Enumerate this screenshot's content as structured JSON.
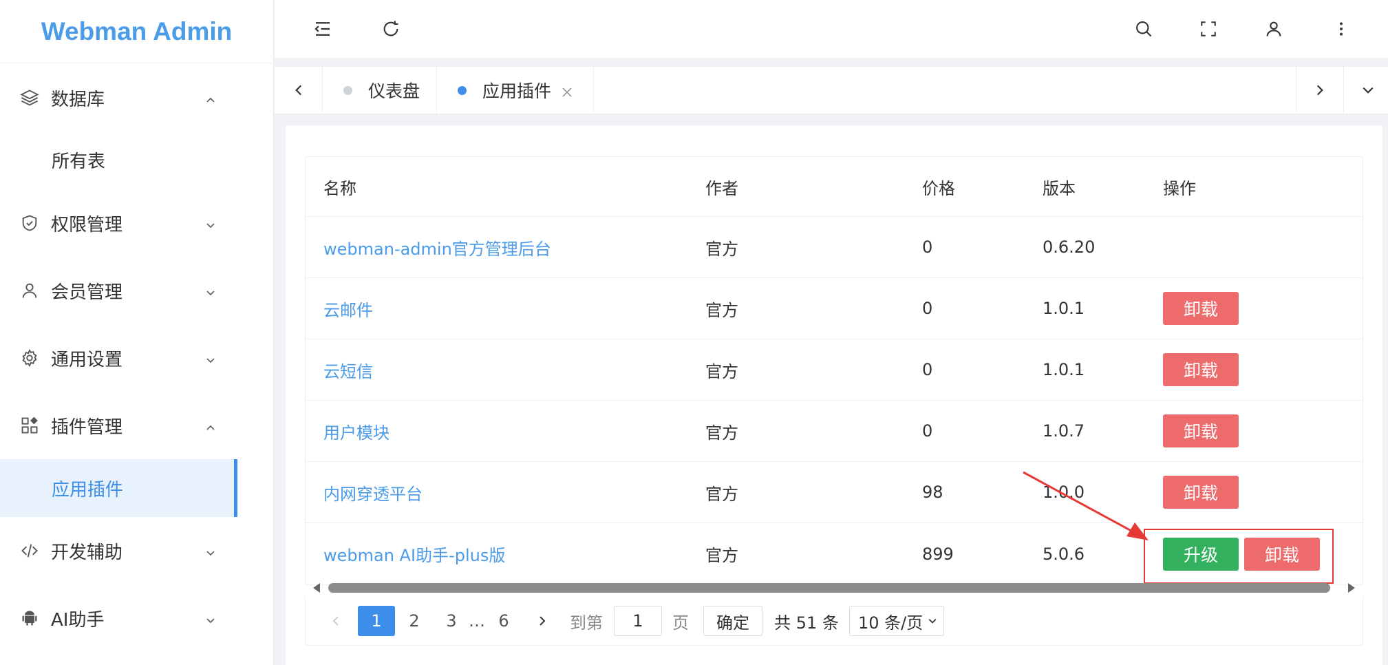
{
  "app": {
    "title": "Webman Admin"
  },
  "sidebar": {
    "items": [
      {
        "label": "数据库",
        "icon": "layers-icon",
        "expanded": true
      },
      {
        "label": "所有表",
        "sub": true
      },
      {
        "label": "权限管理",
        "icon": "shield-icon",
        "expanded": false
      },
      {
        "label": "会员管理",
        "icon": "user-icon",
        "expanded": false
      },
      {
        "label": "通用设置",
        "icon": "gear-icon",
        "expanded": false
      },
      {
        "label": "插件管理",
        "icon": "apps-icon",
        "expanded": true
      },
      {
        "label": "应用插件",
        "sub": true,
        "active": true
      },
      {
        "label": "开发辅助",
        "icon": "code-icon",
        "expanded": false
      },
      {
        "label": "AI助手",
        "icon": "android-icon",
        "expanded": false
      }
    ]
  },
  "tabs": [
    {
      "label": "仪表盘",
      "active": false
    },
    {
      "label": "应用插件",
      "active": true
    }
  ],
  "table": {
    "headers": {
      "name": "名称",
      "author": "作者",
      "price": "价格",
      "version": "版本",
      "ops": "操作"
    },
    "rows": [
      {
        "name": "webman-admin官方管理后台",
        "author": "官方",
        "price": "0",
        "version": "0.6.20",
        "actions": []
      },
      {
        "name": "云邮件",
        "author": "官方",
        "price": "0",
        "version": "1.0.1",
        "actions": [
          "卸载"
        ]
      },
      {
        "name": "云短信",
        "author": "官方",
        "price": "0",
        "version": "1.0.1",
        "actions": [
          "卸载"
        ]
      },
      {
        "name": "用户模块",
        "author": "官方",
        "price": "0",
        "version": "1.0.7",
        "actions": [
          "卸载"
        ]
      },
      {
        "name": "内网穿透平台",
        "author": "官方",
        "price": "98",
        "version": "1.0.0",
        "actions": [
          "卸载"
        ]
      },
      {
        "name": "webman AI助手-plus版",
        "author": "官方",
        "price": "899",
        "version": "5.0.6",
        "actions": [
          "升级",
          "卸载"
        ]
      }
    ]
  },
  "pagination": {
    "pages": [
      "1",
      "2",
      "3",
      "…",
      "6"
    ],
    "current": "1",
    "goto_label": "到第",
    "goto_value": "1",
    "page_unit": "页",
    "confirm": "确定",
    "total": "共 51 条",
    "page_size": "10 条/页"
  },
  "colors": {
    "accent": "#3d8eea",
    "danger": "#ee6b6b",
    "success": "#33b15e",
    "annotation": "#e53935"
  }
}
